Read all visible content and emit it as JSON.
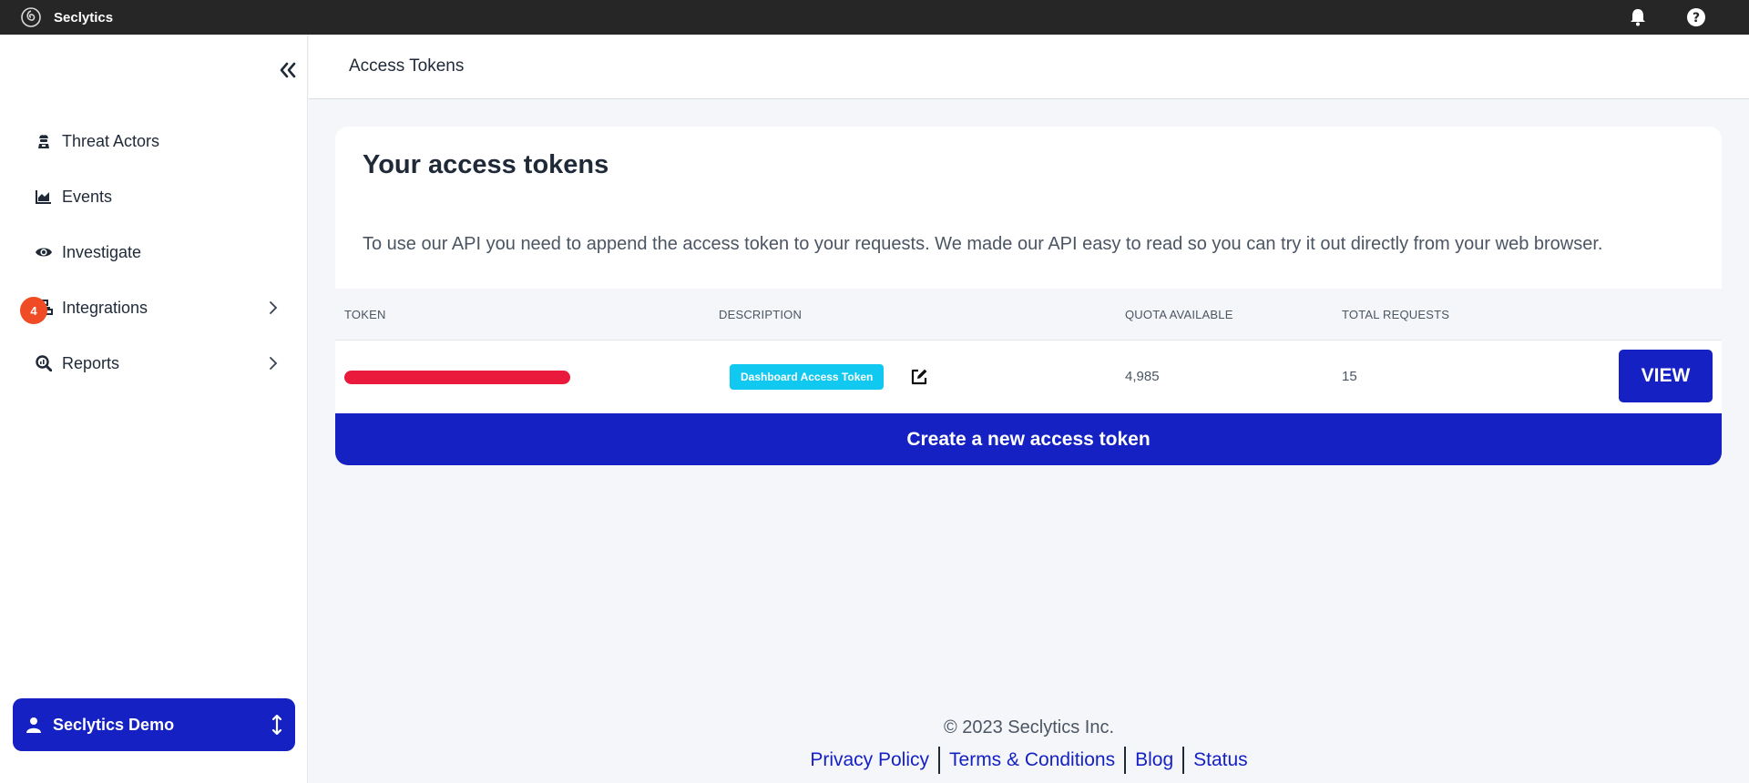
{
  "topbar": {
    "app_name": "Seclytics",
    "icons": [
      "bell-icon",
      "help-icon"
    ]
  },
  "sidebar": {
    "items": [
      {
        "label": "Threat Actors",
        "icon": "threat-actor-icon"
      },
      {
        "label": "Events",
        "icon": "area-chart-icon"
      },
      {
        "label": "Investigate",
        "icon": "eye-icon"
      },
      {
        "label": "Integrations",
        "icon": "integrations-icon",
        "badge": "4",
        "has_submenu": true
      },
      {
        "label": "Reports",
        "icon": "search-report-icon",
        "has_submenu": true
      }
    ],
    "user": {
      "name": "Seclytics Demo"
    }
  },
  "header": {
    "title": "Access Tokens"
  },
  "card": {
    "title": "Your access tokens",
    "description": "To use our API you need to append the access token to your requests. We made our API easy to read so you can try it out directly from your web browser.",
    "columns": [
      "TOKEN",
      "DESCRIPTION",
      "QUOTA AVAILABLE",
      "TOTAL REQUESTS"
    ],
    "rows": [
      {
        "token": "",
        "description": "Dashboard Access Token",
        "quota_available": "4,985",
        "total_requests": "15",
        "action": "VIEW"
      }
    ],
    "create_label": "Create a new access token"
  },
  "footer": {
    "copyright": "© 2023 Seclytics Inc.",
    "links": [
      "Privacy Policy",
      "Terms & Conditions",
      "Blog",
      "Status"
    ]
  },
  "colors": {
    "topbar": "#262626",
    "primary": "#1521c2",
    "badge": "#ef4b24",
    "tag": "#10c8f0",
    "redaction": "#ea1a3c"
  }
}
